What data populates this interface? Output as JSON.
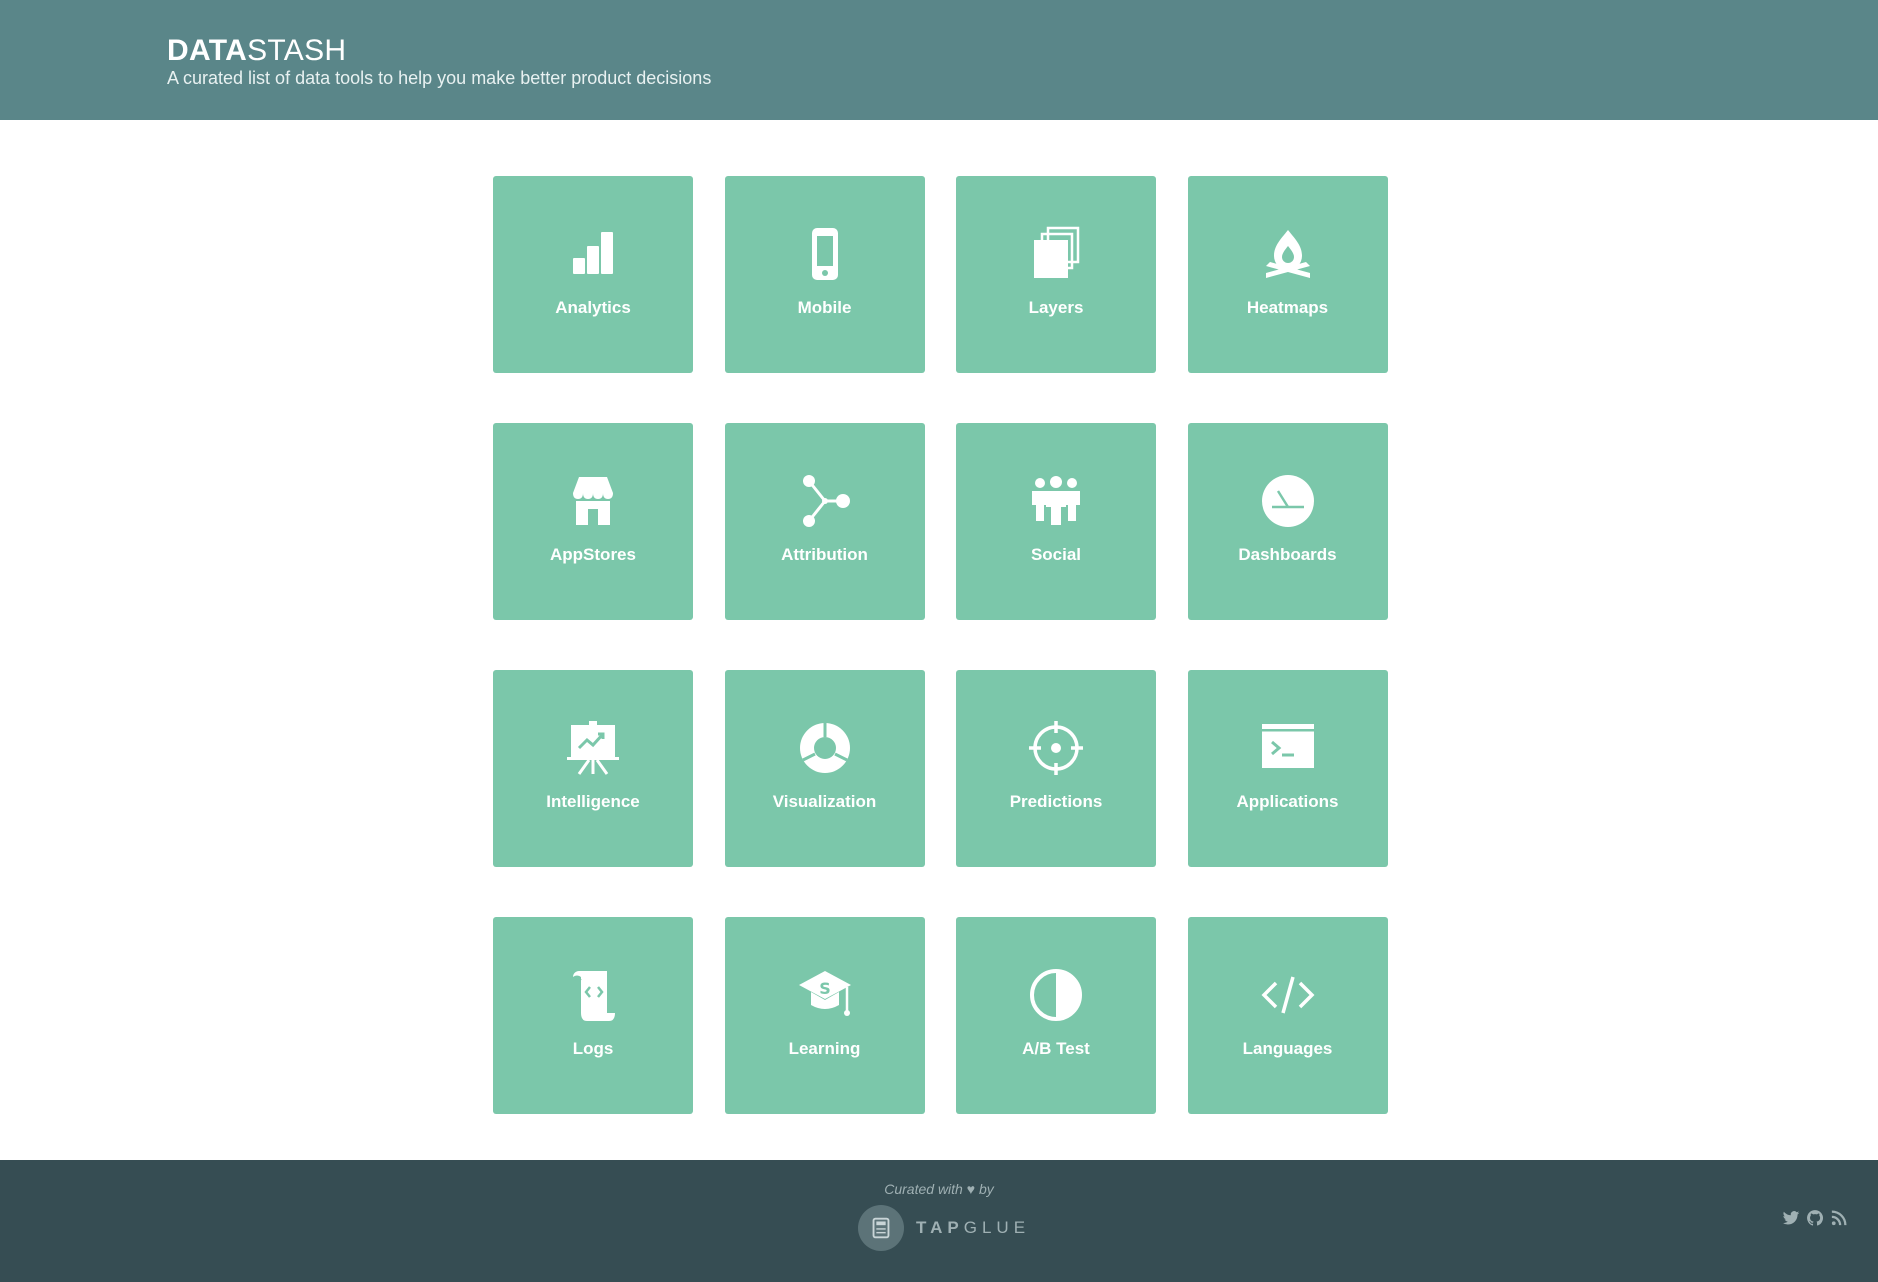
{
  "header": {
    "brand_bold": "DATA",
    "brand_light": "STASH",
    "tagline": "A curated list of data tools to help you make better product decisions"
  },
  "tiles": [
    {
      "label": "Analytics",
      "icon": "bar-chart-icon"
    },
    {
      "label": "Mobile",
      "icon": "mobile-phone-icon"
    },
    {
      "label": "Layers",
      "icon": "layers-icon"
    },
    {
      "label": "Heatmaps",
      "icon": "campfire-icon"
    },
    {
      "label": "AppStores",
      "icon": "storefront-icon"
    },
    {
      "label": "Attribution",
      "icon": "share-nodes-icon"
    },
    {
      "label": "Social",
      "icon": "group-icon"
    },
    {
      "label": "Dashboards",
      "icon": "dashboard-gauge-icon"
    },
    {
      "label": "Intelligence",
      "icon": "presentation-board-icon"
    },
    {
      "label": "Visualization",
      "icon": "donut-chart-icon"
    },
    {
      "label": "Predictions",
      "icon": "crosshair-icon"
    },
    {
      "label": "Applications",
      "icon": "terminal-window-icon"
    },
    {
      "label": "Logs",
      "icon": "code-scroll-icon"
    },
    {
      "label": "Learning",
      "icon": "graduation-cap-icon"
    },
    {
      "label": "A/B Test",
      "icon": "half-circle-contrast-icon"
    },
    {
      "label": "Languages",
      "icon": "code-brackets-icon"
    }
  ],
  "footer": {
    "curated_prefix": "Curated with",
    "curated_suffix": "by",
    "logo_text_bold": "TAP",
    "logo_text_light": "GLUE",
    "social_icons": [
      "twitter-icon",
      "github-icon",
      "rss-icon"
    ]
  },
  "colors": {
    "header_bg": "#5a8689",
    "tile_bg": "#7bc7aa",
    "footer_bg": "#364d53",
    "footer_text": "#9fb0b3"
  }
}
